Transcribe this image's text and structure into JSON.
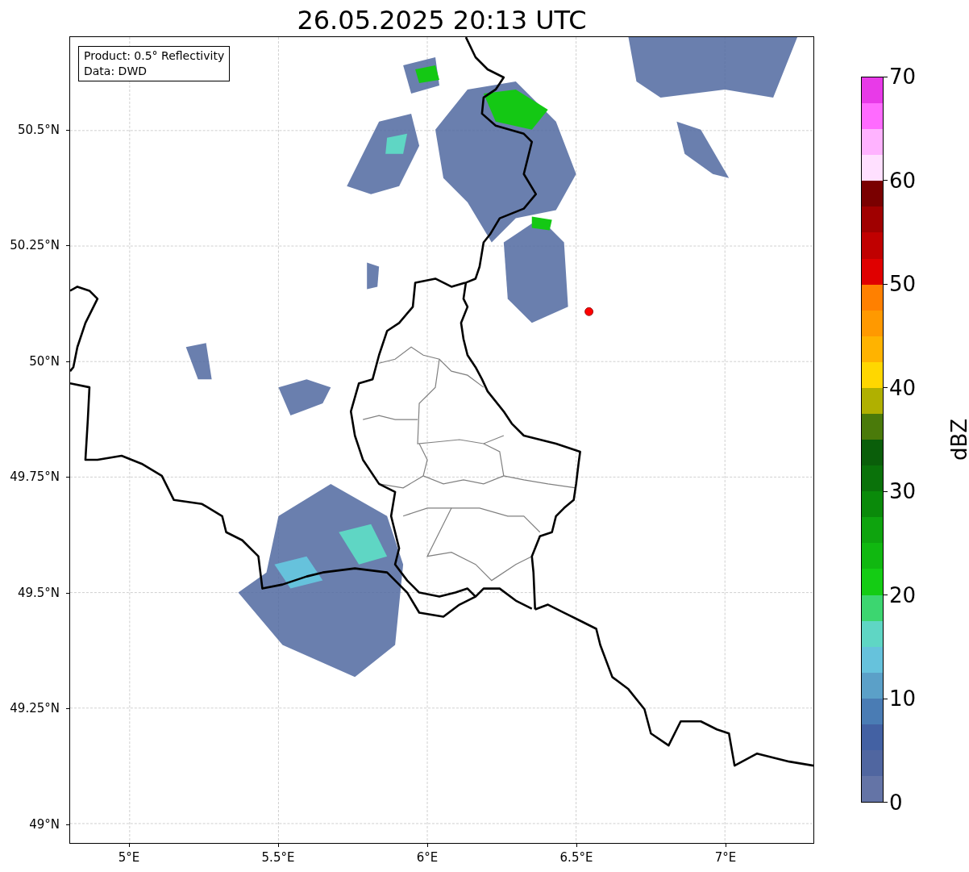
{
  "title": "26.05.2025 20:13 UTC",
  "legend": [
    "Product: 0.5° Reflectivity",
    "Data: DWD"
  ],
  "map": {
    "yticks": [
      "50.5°N",
      "50.25°N",
      "50°N",
      "49.75°N",
      "49.5°N",
      "49.25°N",
      "49°N"
    ],
    "xticks": [
      "5°E",
      "5.5°E",
      "6°E",
      "6.5°E",
      "7°E"
    ]
  },
  "colorbar": {
    "label": "dBZ",
    "ticks": [
      "70",
      "60",
      "50",
      "40",
      "30",
      "20",
      "10",
      "0"
    ],
    "bins": [
      {
        "color": "#e83ae8"
      },
      {
        "color": "#ff6bff"
      },
      {
        "color": "#ffb3ff"
      },
      {
        "color": "#ffe0ff"
      },
      {
        "color": "#7a0000"
      },
      {
        "color": "#a00000"
      },
      {
        "color": "#c00000"
      },
      {
        "color": "#e00000"
      },
      {
        "color": "#ff8000"
      },
      {
        "color": "#ff9900"
      },
      {
        "color": "#ffb300"
      },
      {
        "color": "#ffd700"
      },
      {
        "color": "#b0b000"
      },
      {
        "color": "#4a7a0a"
      },
      {
        "color": "#0a5e0a"
      },
      {
        "color": "#0a720a"
      },
      {
        "color": "#0a8a0a"
      },
      {
        "color": "#0ea40e"
      },
      {
        "color": "#10b810"
      },
      {
        "color": "#14cc14"
      },
      {
        "color": "#3cd670"
      },
      {
        "color": "#5fd6c4"
      },
      {
        "color": "#66c2dc"
      },
      {
        "color": "#5ba0c8"
      },
      {
        "color": "#4a7cb4"
      },
      {
        "color": "#4361a3"
      },
      {
        "color": "#5066a0"
      },
      {
        "color": "#6474a6"
      }
    ]
  }
}
